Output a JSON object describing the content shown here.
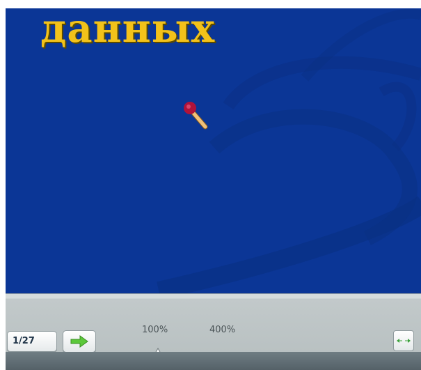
{
  "slide": {
    "title_fragment": "данных"
  },
  "toolbar": {
    "page_indicator": "1/27",
    "next_button_icon": "arrow-right-icon",
    "zoom_min_label": "100%",
    "zoom_max_label": "400%",
    "zoom_level": 0.0,
    "fit_button_icon": "fit-width-icon"
  },
  "colors": {
    "slide_background": "#0b3696",
    "title": "#f3c21a",
    "arrow": "#5cc83a"
  }
}
